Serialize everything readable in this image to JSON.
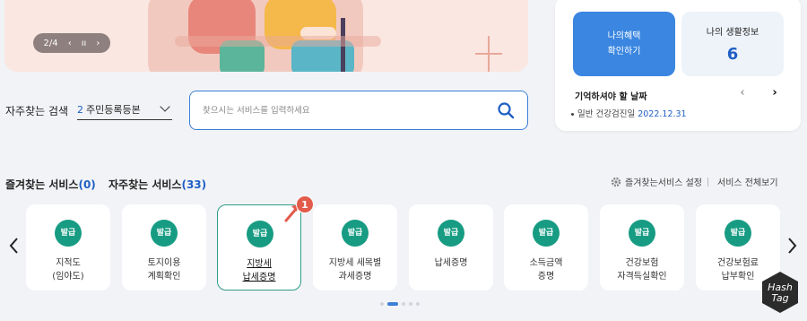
{
  "banner": {
    "page_indicator": "2/4",
    "prev_icon": "chevron-left-icon",
    "pause_icon": "pause-icon",
    "next_icon": "chevron-right-icon"
  },
  "side_card": {
    "benefit_button": "나의혜택\n확인하기",
    "life_info_label": "나의 생활정보",
    "life_info_count": "6",
    "remember_title": "기억하셔야 할 날짜",
    "remember_item_label": "일반 건강검진일",
    "remember_item_date": "2022.12.31"
  },
  "search": {
    "frequent_label": "자주찾는 검색",
    "select_number": "2",
    "select_value": "주민등록등본",
    "placeholder": "찾으시는 서비스를 입력하세요"
  },
  "services": {
    "favorites_label": "즐겨찾는 서비스",
    "favorites_count": "(0)",
    "frequent_label": "자주찾는 서비스",
    "frequent_count": "(33)",
    "settings_label": "즐겨찾는서비스 설정",
    "all_label": "서비스 전체보기",
    "step_number": "1",
    "cards": [
      {
        "badge": "발급",
        "name": "지적도\n(임야도)"
      },
      {
        "badge": "발급",
        "name": "토지이용\n계획확인"
      },
      {
        "badge": "발급",
        "name": "지방세\n납세증명"
      },
      {
        "badge": "발급",
        "name": "지방세 세목별\n과세증명"
      },
      {
        "badge": "발급",
        "name": "납세증명"
      },
      {
        "badge": "발급",
        "name": "소득금액\n증명"
      },
      {
        "badge": "발급",
        "name": "건강보험\n자격득실확인"
      },
      {
        "badge": "발급",
        "name": "건강보험료\n납부확인"
      }
    ]
  },
  "colors": {
    "accent_blue": "#3a86e0",
    "badge_green": "#179c83",
    "selected_border": "#2f9c8c",
    "step_badge": "#e25b4b"
  }
}
